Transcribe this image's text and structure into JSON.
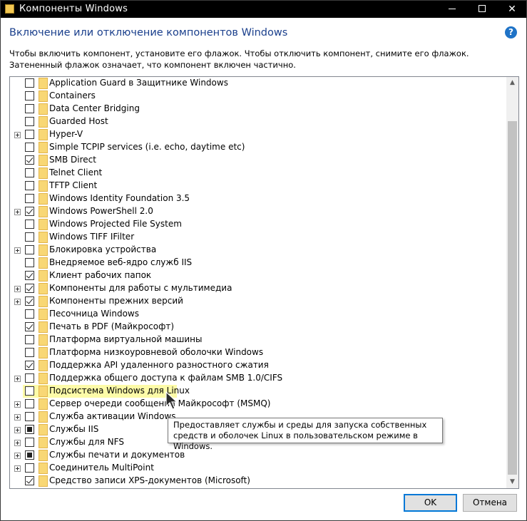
{
  "window": {
    "title": "Компоненты Windows",
    "heading": "Включение или отключение компонентов Windows",
    "description": "Чтобы включить компонент, установите его флажок. Чтобы отключить компонент, снимите его флажок. Затененный флажок означает, что компонент включен частично.",
    "help_glyph": "?"
  },
  "components": [
    {
      "label": "Application Guard в Защитнике Windows",
      "state": "unchecked",
      "expandable": false
    },
    {
      "label": "Containers",
      "state": "unchecked",
      "expandable": false
    },
    {
      "label": "Data Center Bridging",
      "state": "unchecked",
      "expandable": false
    },
    {
      "label": "Guarded Host",
      "state": "unchecked",
      "expandable": false
    },
    {
      "label": "Hyper-V",
      "state": "unchecked",
      "expandable": true
    },
    {
      "label": "Simple TCPIP services (i.e. echo, daytime etc)",
      "state": "unchecked",
      "expandable": false
    },
    {
      "label": "SMB Direct",
      "state": "checked",
      "expandable": false
    },
    {
      "label": "Telnet Client",
      "state": "unchecked",
      "expandable": false
    },
    {
      "label": "TFTP Client",
      "state": "unchecked",
      "expandable": false
    },
    {
      "label": "Windows Identity Foundation 3.5",
      "state": "unchecked",
      "expandable": false
    },
    {
      "label": "Windows PowerShell 2.0",
      "state": "checked",
      "expandable": true
    },
    {
      "label": "Windows Projected File System",
      "state": "unchecked",
      "expandable": false
    },
    {
      "label": "Windows TIFF IFilter",
      "state": "unchecked",
      "expandable": false
    },
    {
      "label": "Блокировка устройства",
      "state": "unchecked",
      "expandable": true
    },
    {
      "label": "Внедряемое веб-ядро служб IIS",
      "state": "unchecked",
      "expandable": false
    },
    {
      "label": "Клиент рабочих папок",
      "state": "checked",
      "expandable": false
    },
    {
      "label": "Компоненты для работы с мультимедиа",
      "state": "checked",
      "expandable": true
    },
    {
      "label": "Компоненты прежних версий",
      "state": "checked",
      "expandable": true
    },
    {
      "label": "Песочница Windows",
      "state": "unchecked",
      "expandable": false
    },
    {
      "label": "Печать в PDF (Майкрософт)",
      "state": "checked",
      "expandable": false
    },
    {
      "label": "Платформа виртуальной машины",
      "state": "unchecked",
      "expandable": false
    },
    {
      "label": "Платформа низкоуровневой оболочки Windows",
      "state": "unchecked",
      "expandable": false
    },
    {
      "label": "Поддержка API удаленного разностного сжатия",
      "state": "checked",
      "expandable": false
    },
    {
      "label": "Поддержка общего доступа к файлам SMB 1.0/CIFS",
      "state": "unchecked",
      "expandable": true
    },
    {
      "label": "Подсистема Windows для Linux",
      "state": "unchecked",
      "expandable": false,
      "highlighted": true
    },
    {
      "label": "Сервер очереди сообщений Майкрософт (MSMQ)",
      "state": "unchecked",
      "expandable": true
    },
    {
      "label": "Служба активации Windows",
      "state": "unchecked",
      "expandable": true
    },
    {
      "label": "Службы IIS",
      "state": "partial",
      "expandable": true
    },
    {
      "label": "Службы для NFS",
      "state": "unchecked",
      "expandable": true
    },
    {
      "label": "Службы печати и документов",
      "state": "partial",
      "expandable": true
    },
    {
      "label": "Соединитель MultiPoint",
      "state": "unchecked",
      "expandable": true
    },
    {
      "label": "Средство записи XPS-документов (Microsoft)",
      "state": "checked",
      "expandable": false
    }
  ],
  "tooltip": {
    "text": "Предоставляет службы и среды для запуска собственных средств и оболочек Linux в пользовательском режиме в Windows."
  },
  "buttons": {
    "ok": "OK",
    "cancel": "Отмена"
  },
  "colors": {
    "heading": "#1a3f8c",
    "highlight": "#fdfba8",
    "ok_border": "#0078d7"
  }
}
